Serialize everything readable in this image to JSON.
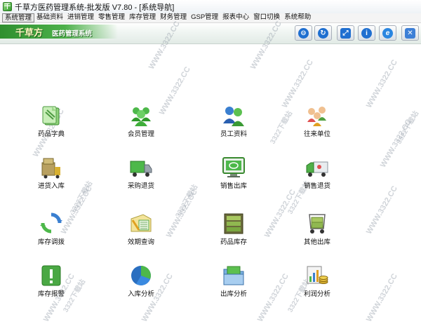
{
  "window": {
    "title": "千草方医药管理系统-批发版 V7.80 - [系统导航]"
  },
  "menu": [
    "系统管理",
    "基础资料",
    "进销管理",
    "零售管理",
    "库存管理",
    "财务管理",
    "GSP管理",
    "报表中心",
    "窗口切换",
    "系统帮助"
  ],
  "banner": {
    "logo": "千草方",
    "subtitle": "医药管理系统"
  },
  "toolbar": [
    "minimize-icon",
    "refresh-icon",
    "maximize-icon",
    "info-icon",
    "browser-icon",
    "close-icon"
  ],
  "nav": [
    {
      "label": "药品字典",
      "icon": "drug-dictionary-icon"
    },
    {
      "label": "会员管理",
      "icon": "members-icon"
    },
    {
      "label": "员工资料",
      "icon": "employees-icon"
    },
    {
      "label": "往来单位",
      "icon": "partners-icon"
    },
    {
      "label": "进货入库",
      "icon": "stock-in-icon"
    },
    {
      "label": "采购退货",
      "icon": "purchase-return-icon"
    },
    {
      "label": "销售出库",
      "icon": "sales-out-icon"
    },
    {
      "label": "销售退货",
      "icon": "sales-return-icon"
    },
    {
      "label": "库存调拨",
      "icon": "stock-transfer-icon"
    },
    {
      "label": "效期查询",
      "icon": "expiry-query-icon"
    },
    {
      "label": "药品库存",
      "icon": "drug-stock-icon"
    },
    {
      "label": "其他出库",
      "icon": "other-out-icon"
    },
    {
      "label": "库存报警",
      "icon": "stock-alert-icon"
    },
    {
      "label": "入库分析",
      "icon": "stock-in-analysis-icon"
    },
    {
      "label": "出库分析",
      "icon": "stock-out-analysis-icon"
    },
    {
      "label": "利润分析",
      "icon": "profit-analysis-icon"
    }
  ],
  "watermark": "WWW.3322.CC",
  "watermark_cn": "3322下载站",
  "colors": {
    "accent_green": "#3ea53a",
    "toolbar_blue": "#1f6fd0",
    "close_red": "#3d7fd6"
  }
}
